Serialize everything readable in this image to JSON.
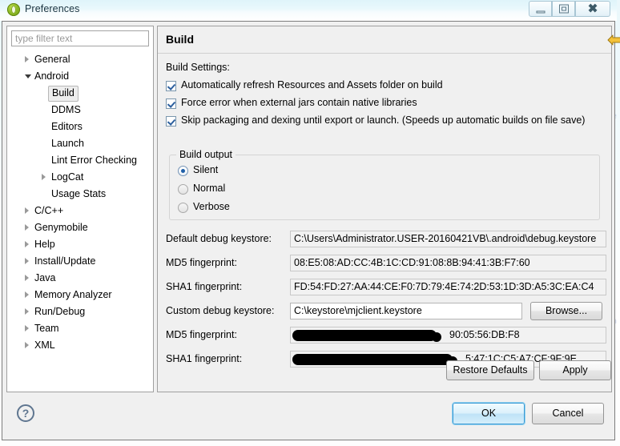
{
  "window": {
    "title": "Preferences",
    "icon": "eclipse-icon",
    "controls": {
      "minimize": "minimize-icon",
      "maximize": "restore-icon",
      "close": "close-icon"
    }
  },
  "sidebar": {
    "filter": {
      "value": "",
      "placeholder": "type filter text"
    },
    "items": [
      {
        "label": "General",
        "depth": 0,
        "arrow": "collapsed",
        "selected": false
      },
      {
        "label": "Android",
        "depth": 0,
        "arrow": "expanded",
        "selected": false
      },
      {
        "label": "Build",
        "depth": 1,
        "arrow": "none",
        "selected": true
      },
      {
        "label": "DDMS",
        "depth": 1,
        "arrow": "none",
        "selected": false
      },
      {
        "label": "Editors",
        "depth": 1,
        "arrow": "none",
        "selected": false
      },
      {
        "label": "Launch",
        "depth": 1,
        "arrow": "none",
        "selected": false
      },
      {
        "label": "Lint Error Checking",
        "depth": 1,
        "arrow": "none",
        "selected": false
      },
      {
        "label": "LogCat",
        "depth": 1,
        "arrow": "collapsed",
        "selected": false
      },
      {
        "label": "Usage Stats",
        "depth": 1,
        "arrow": "none",
        "selected": false
      },
      {
        "label": "C/C++",
        "depth": 0,
        "arrow": "collapsed",
        "selected": false
      },
      {
        "label": "Genymobile",
        "depth": 0,
        "arrow": "collapsed",
        "selected": false
      },
      {
        "label": "Help",
        "depth": 0,
        "arrow": "collapsed",
        "selected": false
      },
      {
        "label": "Install/Update",
        "depth": 0,
        "arrow": "collapsed",
        "selected": false
      },
      {
        "label": "Java",
        "depth": 0,
        "arrow": "collapsed",
        "selected": false
      },
      {
        "label": "Memory Analyzer",
        "depth": 0,
        "arrow": "collapsed",
        "selected": false
      },
      {
        "label": "Run/Debug",
        "depth": 0,
        "arrow": "collapsed",
        "selected": false
      },
      {
        "label": "Team",
        "depth": 0,
        "arrow": "collapsed",
        "selected": false
      },
      {
        "label": "XML",
        "depth": 0,
        "arrow": "collapsed",
        "selected": false
      }
    ]
  },
  "page": {
    "title": "Build",
    "nav": {
      "back": "back-arrow-icon",
      "back_menu": "chevron-down-icon",
      "forward": "forward-arrow-icon",
      "forward_menu": "chevron-down-icon",
      "view_menu": "chevron-down-icon"
    },
    "settings_label": "Build Settings:",
    "checkboxes": [
      {
        "label": "Automatically refresh Resources and Assets folder on build",
        "checked": true
      },
      {
        "label": "Force error when external jars contain native libraries",
        "checked": true
      },
      {
        "label": "Skip packaging and dexing until export or launch. (Speeds up automatic builds on file save)",
        "checked": true
      }
    ],
    "build_output": {
      "legend": "Build output",
      "options": [
        {
          "label": "Silent",
          "selected": true
        },
        {
          "label": "Normal",
          "selected": false
        },
        {
          "label": "Verbose",
          "selected": false
        }
      ]
    },
    "fields": [
      {
        "label": "Default debug keystore:",
        "value": "C:\\Users\\Administrator.USER-20160421VB\\.android\\debug.keystore",
        "editable": false,
        "redacted": false
      },
      {
        "label": "MD5 fingerprint:",
        "value": "08:E5:08:AD:CC:4B:1C:CD:91:08:8B:94:41:3B:F7:60",
        "editable": false,
        "redacted": false
      },
      {
        "label": "SHA1 fingerprint:",
        "value": "FD:54:FD:27:AA:44:CE:F0:7D:79:4E:74:2D:53:1D:3D:A5:3C:EA:C4",
        "editable": false,
        "redacted": false
      },
      {
        "label": "Custom debug keystore:",
        "value": "C:\\keystore\\mjclient.keystore",
        "editable": true,
        "redacted": false,
        "browse": "Browse..."
      },
      {
        "label": "MD5 fingerprint:",
        "value": "90:05:56:DB:F8",
        "editable": false,
        "redacted": true
      },
      {
        "label": "SHA1 fingerprint:",
        "value": "5:47:1C:C5:A7:CF:9F:9E",
        "editable": false,
        "redacted": true
      }
    ],
    "restore_defaults_label": "Restore Defaults",
    "apply_label": "Apply"
  },
  "footer": {
    "help": "?",
    "ok_label": "OK",
    "cancel_label": "Cancel"
  },
  "colors": {
    "accent": "#3c9ad4",
    "checkmark": "#2c5f9e",
    "radio": "#1f5fa8",
    "title_icon": "#8fbb26"
  }
}
